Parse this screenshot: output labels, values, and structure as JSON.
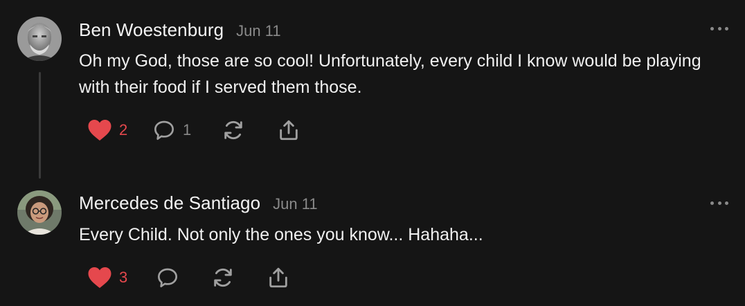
{
  "colors": {
    "background": "#151515",
    "text": "#f0f0f0",
    "muted": "#8a8a8a",
    "like": "#e5484d",
    "thread_line": "#3a3a3a"
  },
  "comments": [
    {
      "author": "Ben Woestenburg",
      "date": "Jun 11",
      "text": "Oh my God, those are so cool! Unfortunately, every child I know would be playing with their food if I served them those.",
      "likes": "2",
      "liked": true,
      "replies": "1",
      "icons": [
        "heart-icon",
        "comment-icon",
        "restack-icon",
        "share-icon",
        "more-icon"
      ]
    },
    {
      "author": "Mercedes de Santiago",
      "date": "Jun 11",
      "text": "Every Child. Not only the ones you know... Hahaha...",
      "likes": "3",
      "liked": true,
      "replies": "",
      "icons": [
        "heart-icon",
        "comment-icon",
        "restack-icon",
        "share-icon",
        "more-icon"
      ]
    }
  ]
}
